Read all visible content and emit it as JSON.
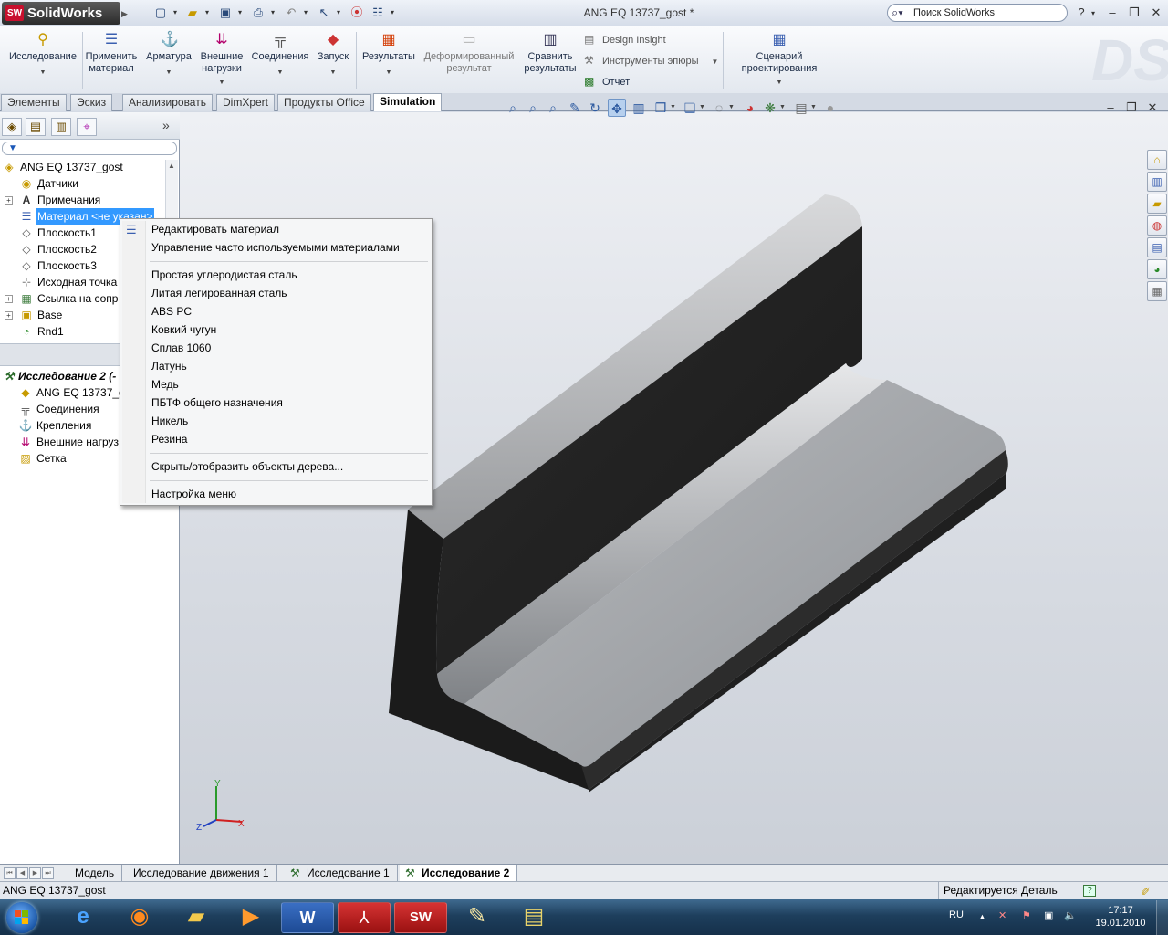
{
  "app": {
    "name": "SolidWorks",
    "document_title": "ANG EQ 13737_gost *"
  },
  "search": {
    "placeholder": "Поиск SolidWorks"
  },
  "command_manager": {
    "buttons": [
      {
        "label": "Исследование"
      },
      {
        "label": "Применить\nматериал"
      },
      {
        "label": "Арматура"
      },
      {
        "label": "Внешние\nнагрузки"
      },
      {
        "label": "Соединения"
      },
      {
        "label": "Запуск"
      },
      {
        "label": "Результаты"
      },
      {
        "label": "Деформированный\nрезультат"
      },
      {
        "label": "Сравнить\nрезультаты"
      },
      {
        "label": "Сценарий\nпроектирования"
      }
    ],
    "small": [
      "Design Insight",
      "Инструменты эпюры",
      "Отчет"
    ]
  },
  "tabs": [
    "Элементы",
    "Эскиз",
    "Анализировать",
    "DimXpert",
    "Продукты Office",
    "Simulation"
  ],
  "tree": {
    "root": "ANG EQ 13737_gost",
    "items": [
      "Датчики",
      "Примечания",
      "Материал <не указан>",
      "Плоскость1",
      "Плоскость2",
      "Плоскость3",
      "Исходная точка",
      "Ссылка на сопр",
      "Base",
      "Rnd1"
    ]
  },
  "study_tree": {
    "root": "Исследование 2 (-",
    "items": [
      "ANG EQ 13737_g",
      "Соединения",
      "Крепления",
      "Внешние нагруз",
      "Сетка"
    ]
  },
  "context_menu": {
    "group1": [
      "Редактировать материал",
      "Управление часто используемыми материалами"
    ],
    "materials": [
      "Простая углеродистая сталь",
      "Литая легированная сталь",
      "ABS PC",
      "Ковкий чугун",
      "Сплав 1060",
      "Латунь",
      "Медь",
      "ПБТФ общего назначения",
      "Никель",
      "Резина"
    ],
    "group3": [
      "Скрыть/отобразить объекты дерева..."
    ],
    "group4": [
      "Настройка меню"
    ]
  },
  "bottom_tabs": [
    "Модель",
    "Исследование движения 1",
    "Исследование 1",
    "Исследование 2"
  ],
  "status": {
    "left": "ANG EQ 13737_gost",
    "right": "Редактируется Деталь",
    "help": "?"
  },
  "taskbar": {
    "lang": "RU",
    "time": "17:17",
    "date": "19.01.2010"
  },
  "triad": {
    "x": "X",
    "y": "Y",
    "z": "Z"
  },
  "colors": {
    "accent": "#3399ff",
    "logo_red": "#c8102e"
  }
}
